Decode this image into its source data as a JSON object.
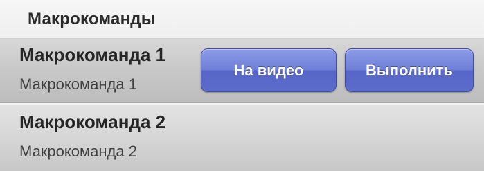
{
  "section": {
    "title": "Макрокоманды"
  },
  "rows": [
    {
      "title": "Макрокоманда 1",
      "subtitle": "Макрокоманда 1",
      "actions": {
        "video_label": "На видео",
        "run_label": "Выполнить"
      }
    },
    {
      "title": "Макрокоманда 2",
      "subtitle": "Макрокоманда 2"
    }
  ],
  "colors": {
    "button_accent": "#6f80d8",
    "button_border": "#3e4ea6"
  }
}
